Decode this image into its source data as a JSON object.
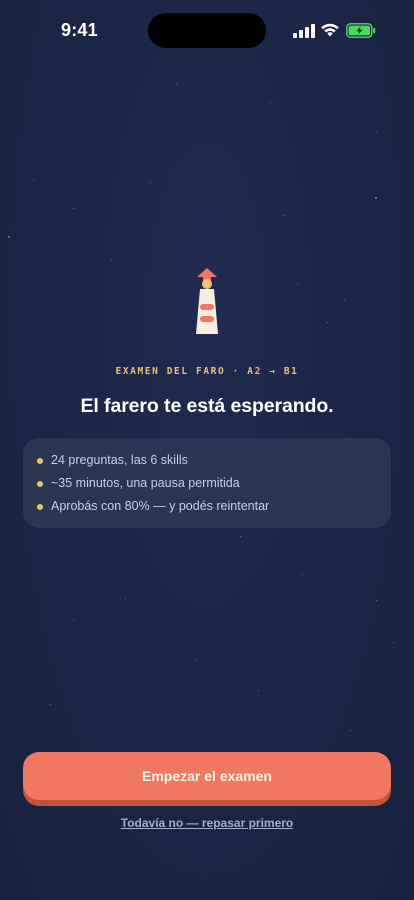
{
  "status_bar": {
    "time": "9:41",
    "signal_icon": "cellular-signal-icon",
    "wifi_icon": "wifi-icon",
    "battery_icon": "battery-charging-icon",
    "battery_color": "#4cd964"
  },
  "hero": {
    "icon": "lighthouse-icon",
    "eyebrow": "EXAMEN DEL FARO · A2 → B1",
    "title": "El farero te está esperando."
  },
  "info_card": {
    "items": [
      "24 preguntas, las 6 skills",
      "~35 minutos, una pausa permitida",
      "Aprobás con 80% — y podés reintentar"
    ]
  },
  "actions": {
    "primary_label": "Empezar el examen",
    "secondary_label": "Todavía no — repasar primero"
  },
  "colors": {
    "background": "#1c2747",
    "accent": "#f07860",
    "eyebrow": "#e8c07a",
    "card": "#2a3552"
  }
}
